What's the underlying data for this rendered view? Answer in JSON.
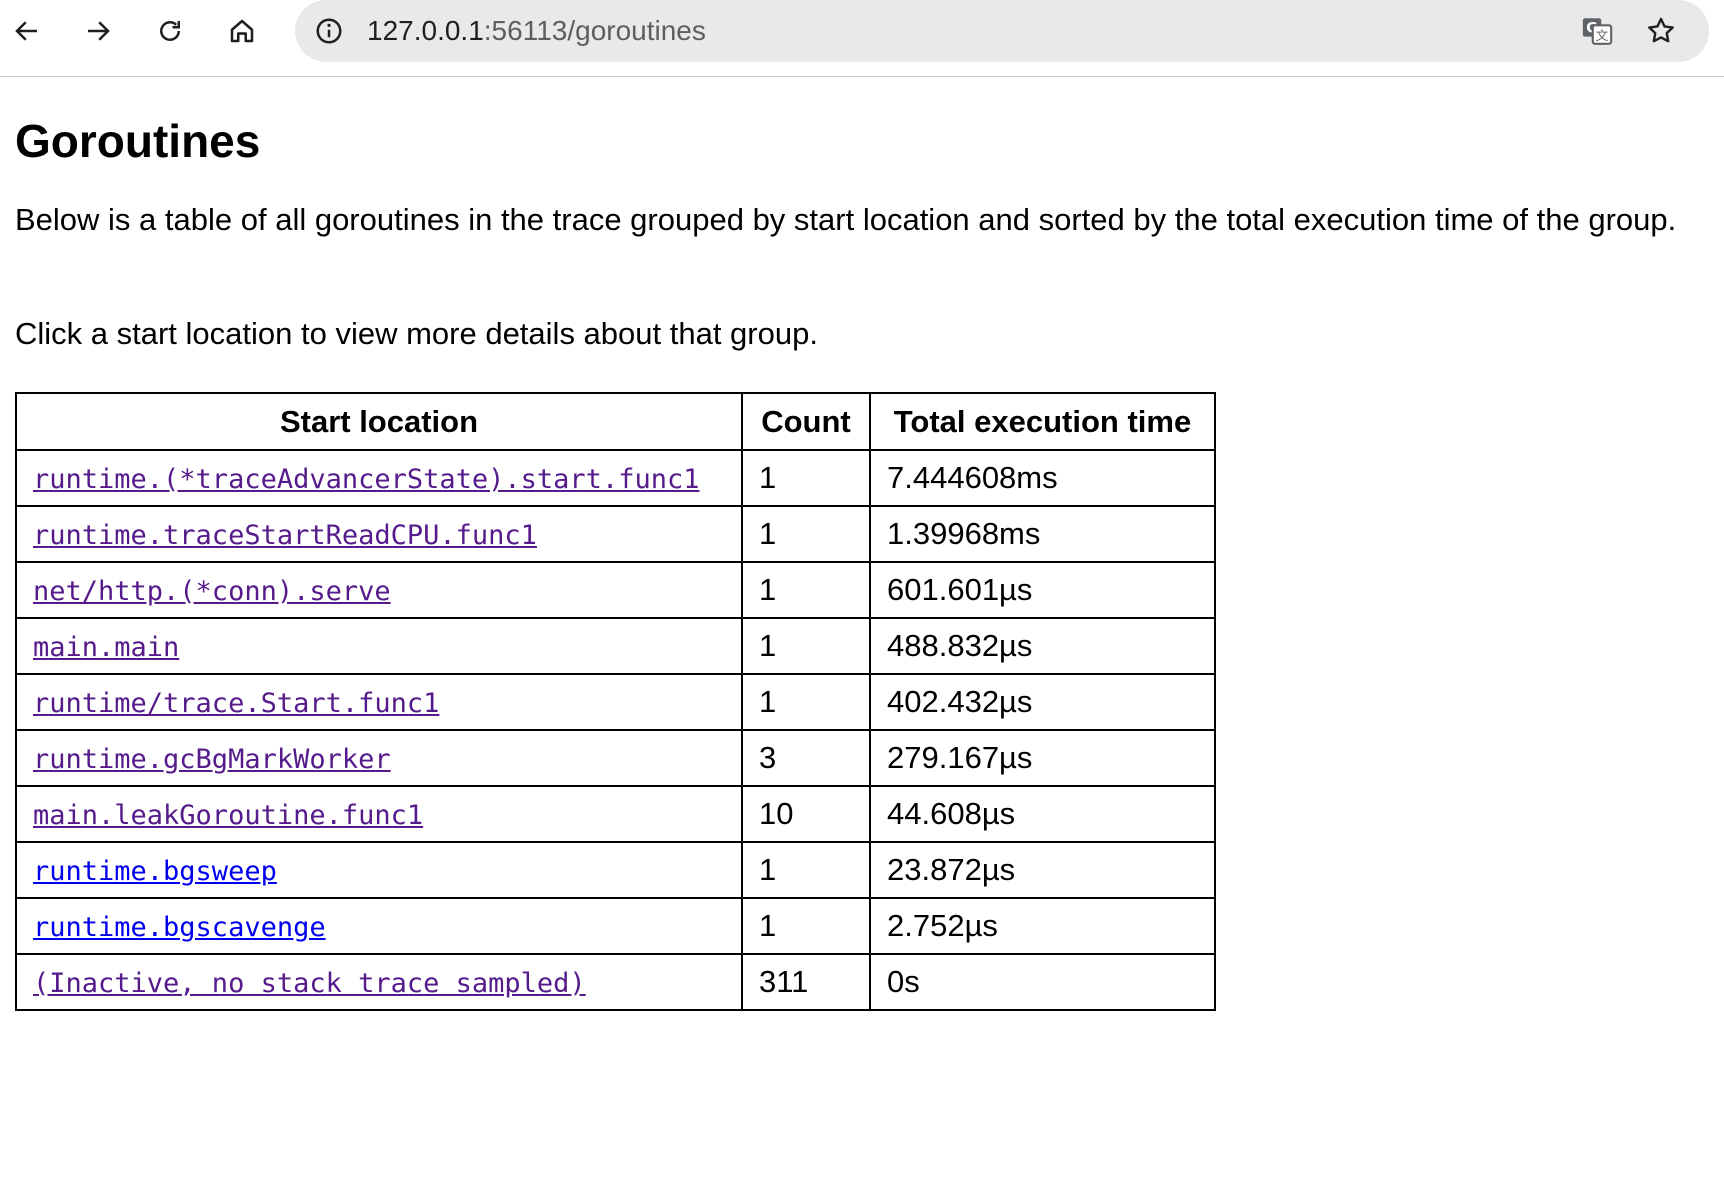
{
  "browser": {
    "url_host": "127.0.0.1",
    "url_rest": ":56113/goroutines",
    "icons": {
      "back": "arrow-left-icon",
      "forward": "arrow-right-icon",
      "reload": "reload-icon",
      "home": "home-icon",
      "site_info": "info-icon",
      "translate": "translate-icon",
      "bookmark": "star-icon"
    }
  },
  "page": {
    "title": "Goroutines",
    "intro": "Below is a table of all goroutines in the trace grouped by start location and sorted by the total execution time of the group.",
    "hint": "Click a start location to view more details about that group."
  },
  "table": {
    "headers": [
      "Start location",
      "Count",
      "Total execution time"
    ],
    "rows": [
      {
        "location": "runtime.(*traceAdvancerState).start.func1",
        "count": "1",
        "time": "7.444608ms",
        "visited": true
      },
      {
        "location": "runtime.traceStartReadCPU.func1",
        "count": "1",
        "time": "1.39968ms",
        "visited": true
      },
      {
        "location": "net/http.(*conn).serve",
        "count": "1",
        "time": "601.601µs",
        "visited": true
      },
      {
        "location": "main.main",
        "count": "1",
        "time": "488.832µs",
        "visited": true
      },
      {
        "location": "runtime/trace.Start.func1",
        "count": "1",
        "time": "402.432µs",
        "visited": true
      },
      {
        "location": "runtime.gcBgMarkWorker",
        "count": "3",
        "time": "279.167µs",
        "visited": true
      },
      {
        "location": "main.leakGoroutine.func1",
        "count": "10",
        "time": "44.608µs",
        "visited": true
      },
      {
        "location": "runtime.bgsweep",
        "count": "1",
        "time": "23.872µs",
        "visited": false
      },
      {
        "location": "runtime.bgscavenge",
        "count": "1",
        "time": "2.752µs",
        "visited": false
      },
      {
        "location": "(Inactive, no stack trace sampled)",
        "count": "311",
        "time": "0s",
        "visited": true
      }
    ]
  },
  "colors": {
    "link_visited": "#551a8b",
    "link_unvisited": "#0000ee",
    "omnibox_bg": "#e9e9e9"
  }
}
